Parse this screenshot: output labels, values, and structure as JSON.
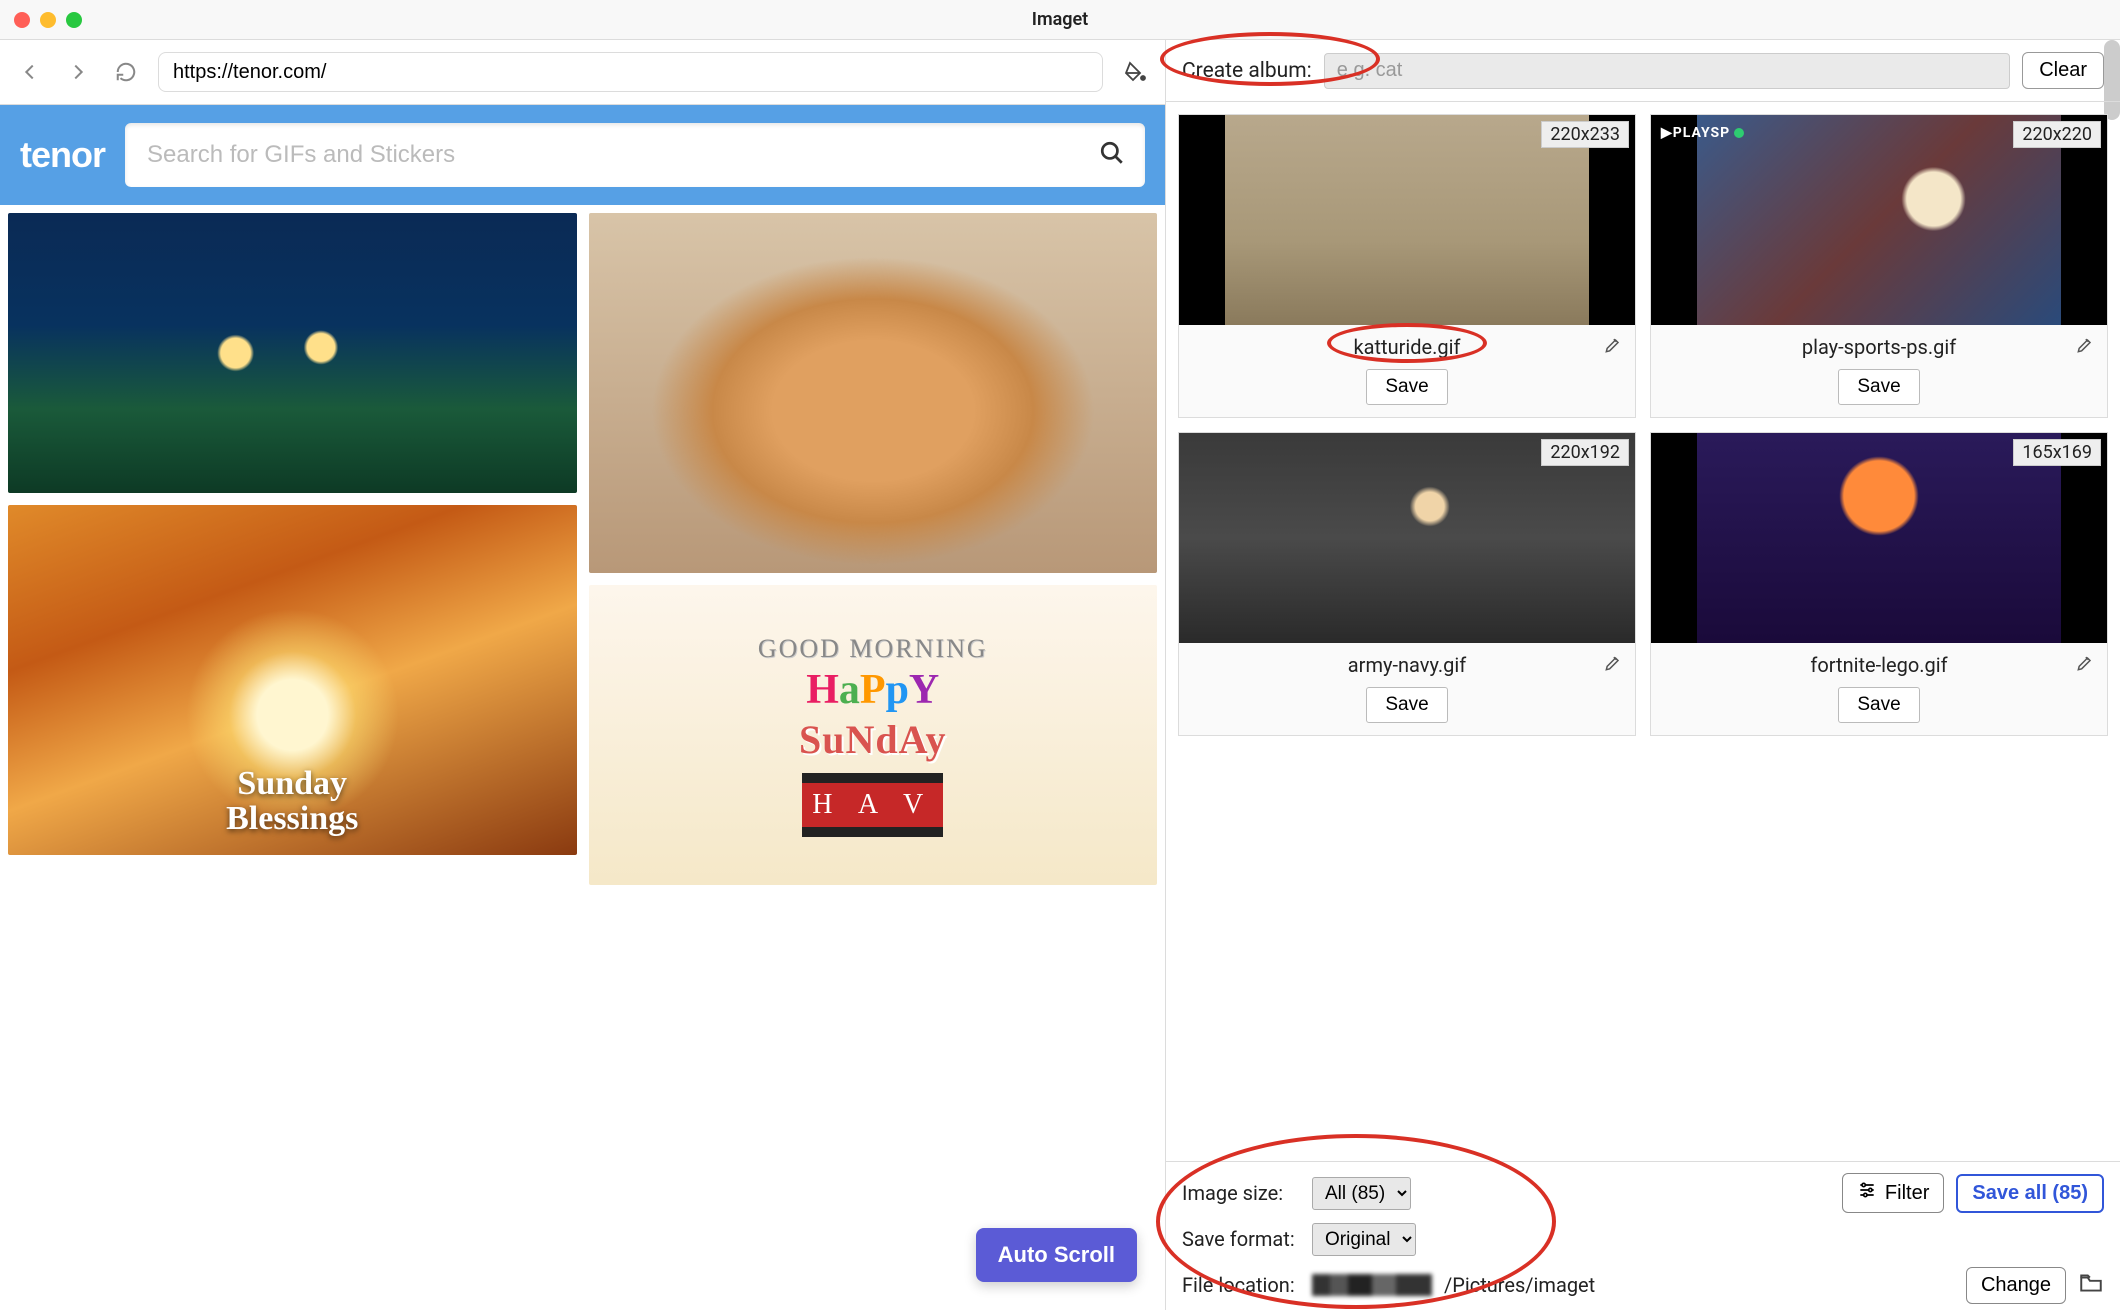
{
  "window": {
    "title": "Imaget"
  },
  "browser": {
    "url": "https://tenor.com/"
  },
  "tenor": {
    "logo": "tenor",
    "search_placeholder": "Search for GIFs and Stickers",
    "tiles": {
      "autumn_overlay_line1": "Sunday",
      "autumn_overlay_line2": "Blessings",
      "sunday_gm": "GOOD MORNING",
      "sunday_happy": "HaPpY",
      "sunday_sun": "SuNdAy",
      "sunday_film": "H A V"
    },
    "auto_scroll": "Auto Scroll"
  },
  "album": {
    "label": "Create album:",
    "placeholder": "e.g. cat",
    "clear": "Clear"
  },
  "cards": [
    {
      "dim": "220x233",
      "filename": "katturide.gif",
      "thumb": "katturide",
      "watermark": ""
    },
    {
      "dim": "220x220",
      "filename": "play-sports-ps.gif",
      "thumb": "playsports",
      "watermark": "▶PLAYSP"
    },
    {
      "dim": "220x192",
      "filename": "army-navy.gif",
      "thumb": "army",
      "watermark": ""
    },
    {
      "dim": "165x169",
      "filename": "fortnite-lego.gif",
      "thumb": "fortnite",
      "watermark": ""
    }
  ],
  "card_actions": {
    "save": "Save"
  },
  "controls": {
    "image_size_label": "Image size:",
    "image_size_value": "All (85)",
    "save_format_label": "Save format:",
    "save_format_value": "Original",
    "file_location_label": "File location:",
    "file_location_path": "/Pictures/imaget",
    "filter": "Filter",
    "save_all": "Save all (85)",
    "change": "Change"
  }
}
